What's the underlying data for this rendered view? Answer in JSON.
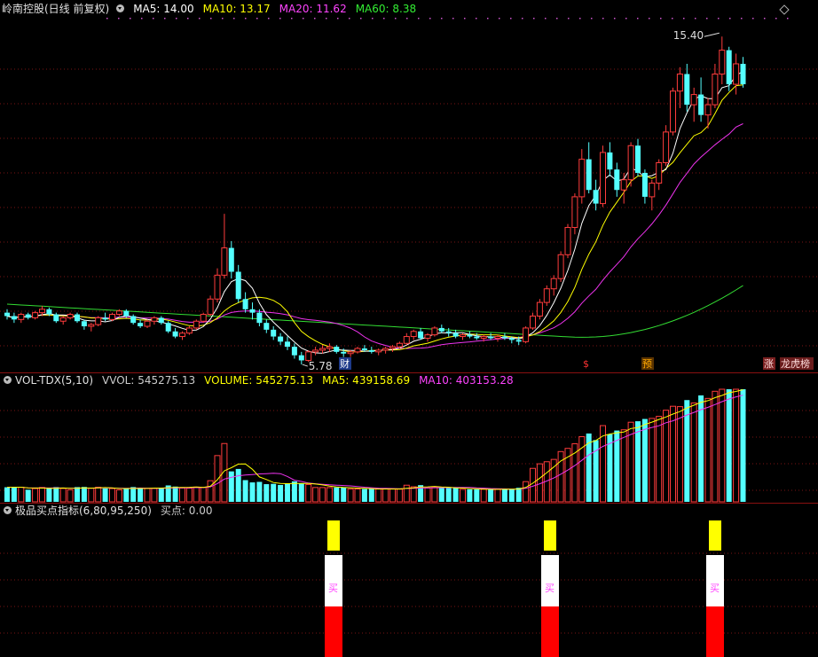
{
  "main_panel": {
    "title": "岭南控股(日线 前复权)",
    "indicators": [
      {
        "label": "MA5: 14.00",
        "color": "#ffffff"
      },
      {
        "label": "MA10: 13.17",
        "color": "#ffff00"
      },
      {
        "label": "MA20: 11.62",
        "color": "#ff44ff"
      },
      {
        "label": "MA60: 8.38",
        "color": "#33ee33"
      }
    ],
    "high_label": "15.40",
    "low_label": "5.78",
    "markers": [
      {
        "text": "财",
        "color": "#ffffff",
        "bg": "#1e3a8a"
      },
      {
        "text": "$",
        "color": "#ff3333",
        "bg": "none"
      },
      {
        "text": "预",
        "color": "#ffaa00",
        "bg": "#5a3300"
      },
      {
        "text": "涨",
        "color": "#ffdddd",
        "bg": "#7a2020"
      },
      {
        "text": "龙虎榜",
        "color": "#ffdddd",
        "bg": "#6a1c1c"
      }
    ]
  },
  "volume_panel": {
    "title": "VOL-TDX(5,10)",
    "indicators": [
      {
        "label": "VVOL: 545275.13",
        "color": "#cccccc"
      },
      {
        "label": "VOLUME: 545275.13",
        "color": "#ffff00"
      },
      {
        "label": "MA5: 439158.69",
        "color": "#ffff00"
      },
      {
        "label": "MA10: 403153.28",
        "color": "#ff44ff"
      }
    ]
  },
  "signal_panel": {
    "title": "极品买点指标(6,80,95,250)",
    "indicators": [
      {
        "label": "买点: 0.00",
        "color": "#cccccc"
      }
    ],
    "signal_label": "买"
  },
  "chart_data": [
    {
      "type": "candlestick",
      "title": "岭南控股(日线 前复权)",
      "series": [
        {
          "name": "MA5",
          "last": 14.0
        },
        {
          "name": "MA10",
          "last": 13.17
        },
        {
          "name": "MA20",
          "last": 11.62
        },
        {
          "name": "MA60",
          "last": 8.38
        }
      ],
      "ohlc": [
        [
          7.3,
          7.4,
          7.1,
          7.2
        ],
        [
          7.2,
          7.3,
          7.0,
          7.1
        ],
        [
          7.1,
          7.3,
          7.0,
          7.25
        ],
        [
          7.25,
          7.3,
          7.1,
          7.15
        ],
        [
          7.15,
          7.35,
          7.1,
          7.3
        ],
        [
          7.3,
          7.5,
          7.2,
          7.4
        ],
        [
          7.4,
          7.45,
          7.2,
          7.25
        ],
        [
          7.25,
          7.3,
          7.0,
          7.05
        ],
        [
          7.05,
          7.2,
          6.95,
          7.15
        ],
        [
          7.15,
          7.3,
          7.1,
          7.25
        ],
        [
          7.25,
          7.3,
          7.0,
          7.05
        ],
        [
          7.05,
          7.1,
          6.8,
          6.9
        ],
        [
          6.9,
          7.0,
          6.75,
          6.95
        ],
        [
          6.95,
          7.2,
          6.9,
          7.15
        ],
        [
          7.15,
          7.3,
          7.05,
          7.1
        ],
        [
          7.1,
          7.3,
          7.05,
          7.25
        ],
        [
          7.25,
          7.4,
          7.2,
          7.35
        ],
        [
          7.35,
          7.4,
          7.15,
          7.2
        ],
        [
          7.2,
          7.25,
          6.95,
          7.0
        ],
        [
          7.0,
          7.1,
          6.85,
          6.9
        ],
        [
          6.9,
          7.1,
          6.85,
          7.05
        ],
        [
          7.05,
          7.2,
          6.95,
          7.15
        ],
        [
          7.15,
          7.2,
          6.95,
          7.0
        ],
        [
          7.0,
          7.05,
          6.7,
          6.75
        ],
        [
          6.75,
          6.85,
          6.55,
          6.6
        ],
        [
          6.6,
          6.75,
          6.5,
          6.7
        ],
        [
          6.7,
          6.9,
          6.65,
          6.85
        ],
        [
          6.85,
          7.1,
          6.8,
          7.05
        ],
        [
          7.05,
          7.3,
          7.0,
          7.25
        ],
        [
          7.25,
          7.8,
          7.2,
          7.7
        ],
        [
          7.7,
          8.6,
          7.6,
          8.4
        ],
        [
          8.4,
          10.2,
          8.3,
          9.2
        ],
        [
          9.2,
          9.4,
          8.3,
          8.5
        ],
        [
          8.5,
          8.7,
          7.6,
          7.7
        ],
        [
          7.7,
          7.9,
          7.3,
          7.4
        ],
        [
          7.4,
          7.6,
          7.1,
          7.3
        ],
        [
          7.3,
          7.4,
          6.9,
          7.0
        ],
        [
          7.0,
          7.1,
          6.7,
          6.8
        ],
        [
          6.8,
          6.9,
          6.5,
          6.6
        ],
        [
          6.6,
          6.7,
          6.35,
          6.45
        ],
        [
          6.45,
          6.6,
          6.2,
          6.3
        ],
        [
          6.3,
          6.4,
          5.95,
          6.05
        ],
        [
          6.05,
          6.15,
          5.78,
          5.9
        ],
        [
          5.9,
          6.2,
          5.85,
          6.15
        ],
        [
          6.15,
          6.3,
          6.05,
          6.2
        ],
        [
          6.2,
          6.35,
          6.1,
          6.25
        ],
        [
          6.25,
          6.4,
          6.15,
          6.3
        ],
        [
          6.3,
          6.35,
          6.1,
          6.15
        ],
        [
          6.15,
          6.25,
          6.0,
          6.1
        ],
        [
          6.1,
          6.2,
          6.0,
          6.15
        ],
        [
          6.15,
          6.3,
          6.1,
          6.25
        ],
        [
          6.25,
          6.35,
          6.15,
          6.2
        ],
        [
          6.2,
          6.3,
          6.1,
          6.15
        ],
        [
          6.15,
          6.25,
          6.05,
          6.2
        ],
        [
          6.2,
          6.3,
          6.1,
          6.25
        ],
        [
          6.25,
          6.35,
          6.15,
          6.3
        ],
        [
          6.3,
          6.45,
          6.25,
          6.4
        ],
        [
          6.4,
          6.7,
          6.35,
          6.6
        ],
        [
          6.6,
          6.8,
          6.5,
          6.75
        ],
        [
          6.75,
          6.85,
          6.5,
          6.55
        ],
        [
          6.55,
          6.7,
          6.45,
          6.65
        ],
        [
          6.65,
          6.9,
          6.6,
          6.85
        ],
        [
          6.85,
          6.95,
          6.7,
          6.75
        ],
        [
          6.75,
          6.85,
          6.6,
          6.7
        ],
        [
          6.7,
          6.8,
          6.55,
          6.6
        ],
        [
          6.6,
          6.7,
          6.5,
          6.65
        ],
        [
          6.65,
          6.75,
          6.55,
          6.6
        ],
        [
          6.6,
          6.7,
          6.5,
          6.55
        ],
        [
          6.55,
          6.65,
          6.45,
          6.6
        ],
        [
          6.6,
          6.7,
          6.5,
          6.55
        ],
        [
          6.55,
          6.65,
          6.45,
          6.6
        ],
        [
          6.6,
          6.7,
          6.5,
          6.55
        ],
        [
          6.55,
          6.6,
          6.4,
          6.5
        ],
        [
          6.5,
          6.6,
          6.35,
          6.45
        ],
        [
          6.45,
          6.9,
          6.4,
          6.85
        ],
        [
          6.85,
          7.3,
          6.8,
          7.2
        ],
        [
          7.2,
          7.7,
          7.1,
          7.6
        ],
        [
          7.6,
          8.1,
          7.5,
          8.0
        ],
        [
          8.0,
          8.4,
          7.8,
          8.3
        ],
        [
          8.3,
          9.1,
          8.2,
          9.0
        ],
        [
          9.0,
          9.9,
          8.9,
          9.8
        ],
        [
          9.8,
          10.8,
          9.6,
          10.7
        ],
        [
          10.7,
          12.1,
          10.5,
          11.8
        ],
        [
          11.8,
          12.3,
          10.8,
          10.9
        ],
        [
          10.9,
          11.2,
          10.3,
          10.5
        ],
        [
          10.5,
          12.2,
          10.4,
          12.0
        ],
        [
          12.0,
          12.3,
          11.3,
          11.5
        ],
        [
          11.5,
          11.7,
          10.7,
          10.9
        ],
        [
          10.9,
          11.4,
          10.5,
          11.2
        ],
        [
          11.2,
          12.3,
          11.0,
          12.2
        ],
        [
          12.2,
          12.4,
          11.3,
          11.4
        ],
        [
          11.4,
          11.5,
          10.5,
          10.7
        ],
        [
          10.7,
          11.2,
          10.3,
          11.1
        ],
        [
          11.1,
          11.8,
          10.9,
          11.7
        ],
        [
          11.7,
          12.8,
          11.6,
          12.6
        ],
        [
          12.6,
          13.9,
          12.5,
          13.8
        ],
        [
          13.8,
          14.5,
          13.3,
          14.3
        ],
        [
          14.3,
          14.6,
          13.2,
          13.4
        ],
        [
          13.4,
          13.9,
          12.9,
          13.7
        ],
        [
          13.7,
          14.2,
          12.9,
          13.1
        ],
        [
          13.1,
          13.6,
          12.7,
          13.4
        ],
        [
          13.4,
          14.6,
          13.3,
          14.3
        ],
        [
          14.3,
          15.4,
          14.0,
          15.0
        ],
        [
          15.0,
          15.1,
          13.8,
          14.0
        ],
        [
          14.0,
          14.9,
          13.7,
          14.6
        ],
        [
          14.6,
          14.8,
          13.9,
          14.0
        ]
      ]
    }
  ]
}
